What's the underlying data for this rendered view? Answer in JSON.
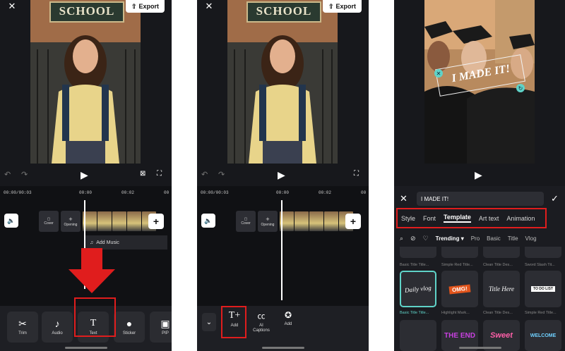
{
  "editor": {
    "export_label": "Export",
    "sign_text": "SCHOOL",
    "time_current": "00:00/00:03",
    "time_marks": [
      "00:00",
      "00:02",
      "00"
    ],
    "cover_label": "Cover",
    "opening_label": "Opening",
    "add_music_label": "Add Music"
  },
  "panel1": {
    "tools": [
      {
        "label": "Trim",
        "icon": "scissors-icon"
      },
      {
        "label": "Audio",
        "icon": "music-note-icon"
      },
      {
        "label": "Text",
        "icon": "text-icon"
      },
      {
        "label": "Sticker",
        "icon": "sticker-icon"
      },
      {
        "label": "PIP",
        "icon": "pip-icon"
      }
    ]
  },
  "panel2": {
    "tools": [
      {
        "label": "Add",
        "icon": "add-text-icon"
      },
      {
        "label": "AI Captions",
        "icon": "ai-captions-icon"
      },
      {
        "label": "Add",
        "icon": "add-sticker-icon"
      }
    ]
  },
  "panel3": {
    "overlay_text": "I MADE IT!",
    "input_value": "I MADE IT!",
    "tabs": [
      "Style",
      "Font",
      "Template",
      "Art text",
      "Animation"
    ],
    "active_tab": "Template",
    "filters": [
      "Trending",
      "Pro",
      "Basic",
      "Title",
      "Vlog"
    ],
    "templates_row1": [
      {
        "preview": "",
        "caption": "Basic Title Title..."
      },
      {
        "preview": "",
        "caption": "Simple Red Title..."
      },
      {
        "preview": "",
        "caption": "Clean Title Des..."
      },
      {
        "preview": "",
        "caption": "Sword Slash Tit..."
      }
    ],
    "templates_row2": [
      {
        "preview": "Daily vlog",
        "caption": "Basic Title Title..."
      },
      {
        "preview": "OMG!",
        "caption": "Highlight Mark..."
      },
      {
        "preview": "Title Here",
        "caption": "Clean Title Des..."
      },
      {
        "preview": "TO DO LIST",
        "caption": "Simple Red Title..."
      }
    ],
    "templates_row3": [
      {
        "preview": "",
        "caption": ""
      },
      {
        "preview": "THE END",
        "caption": ""
      },
      {
        "preview": "Sweet",
        "caption": ""
      },
      {
        "preview": "WELCOME",
        "caption": ""
      }
    ]
  },
  "colors": {
    "highlight_red": "#e01d1d",
    "background": "#17181c",
    "accent_teal": "#5fd3c8"
  }
}
